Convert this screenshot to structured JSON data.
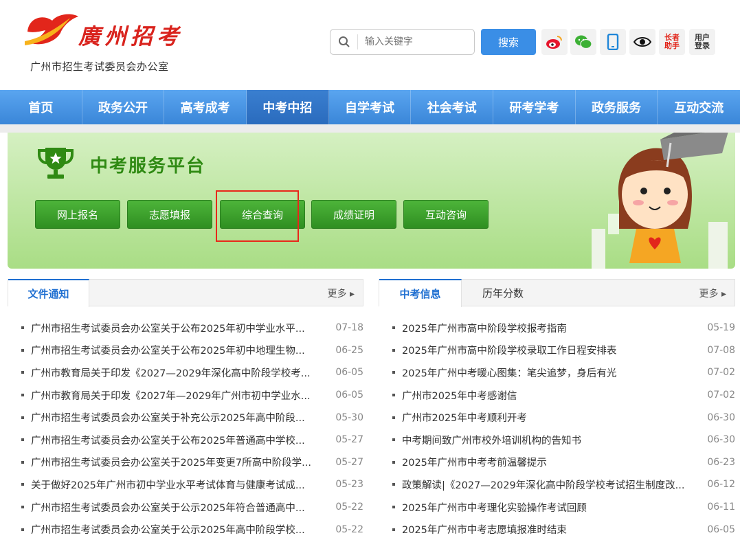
{
  "header": {
    "logo_title": "廣州招考",
    "logo_subtitle": "广州市招生考试委员会办公室",
    "search_placeholder": "输入关键字",
    "search_button": "搜索",
    "elder_helper": [
      "长者",
      "助手"
    ],
    "user_login": [
      "用户",
      "登录"
    ]
  },
  "nav": {
    "items": [
      "首页",
      "政务公开",
      "高考成考",
      "中考中招",
      "自学考试",
      "社会考试",
      "研考学考",
      "政务服务",
      "互动交流"
    ],
    "active_index": 3
  },
  "banner": {
    "title": "中考服务平台",
    "buttons": [
      "网上报名",
      "志愿填报",
      "综合查询",
      "成绩证明",
      "互动咨询"
    ],
    "highlighted": "综合查询"
  },
  "left_panel": {
    "tab_active": "文件通知",
    "more": "更多",
    "items": [
      {
        "title": "广州市招生考试委员会办公室关于公布2025年初中学业水平...",
        "date": "07-18"
      },
      {
        "title": "广州市招生考试委员会办公室关于公布2025年初中地理生物...",
        "date": "06-25"
      },
      {
        "title": "广州市教育局关于印发《2027—2029年深化高中阶段学校考...",
        "date": "06-05"
      },
      {
        "title": "广州市教育局关于印发《2027年—2029年广州市初中学业水...",
        "date": "06-05"
      },
      {
        "title": "广州市招生考试委员会办公室关于补充公示2025年高中阶段...",
        "date": "05-30"
      },
      {
        "title": "广州市招生考试委员会办公室关于公布2025年普通高中学校...",
        "date": "05-27"
      },
      {
        "title": "广州市招生考试委员会办公室关于2025年变更7所高中阶段学...",
        "date": "05-27"
      },
      {
        "title": "关于做好2025年广州市初中学业水平考试体育与健康考试成...",
        "date": "05-23"
      },
      {
        "title": "广州市招生考试委员会办公室关于公示2025年符合普通高中...",
        "date": "05-22"
      },
      {
        "title": "广州市招生考试委员会办公室关于公示2025年高中阶段学校...",
        "date": "05-22"
      }
    ]
  },
  "right_panel": {
    "tab_active": "中考信息",
    "tab_other": "历年分数",
    "more": "更多",
    "items": [
      {
        "title": "2025年广州市高中阶段学校报考指南",
        "date": "05-19"
      },
      {
        "title": "2025年广州市高中阶段学校录取工作日程安排表",
        "date": "07-08"
      },
      {
        "title": "2025年广州中考暖心图集：笔尖追梦，身后有光",
        "date": "07-02"
      },
      {
        "title": "广州市2025年中考感谢信",
        "date": "07-02"
      },
      {
        "title": "广州市2025年中考顺利开考",
        "date": "06-30"
      },
      {
        "title": "中考期间致广州市校外培训机构的告知书",
        "date": "06-30"
      },
      {
        "title": "2025年广州市中考考前温馨提示",
        "date": "06-23"
      },
      {
        "title": "政策解读|《2027—2029年深化高中阶段学校考试招生制度改...",
        "date": "06-12"
      },
      {
        "title": "2025年广州市中考理化实验操作考试回顾",
        "date": "06-11"
      },
      {
        "title": "2025年广州市中考志愿填报准时结束",
        "date": "06-05"
      }
    ]
  }
}
